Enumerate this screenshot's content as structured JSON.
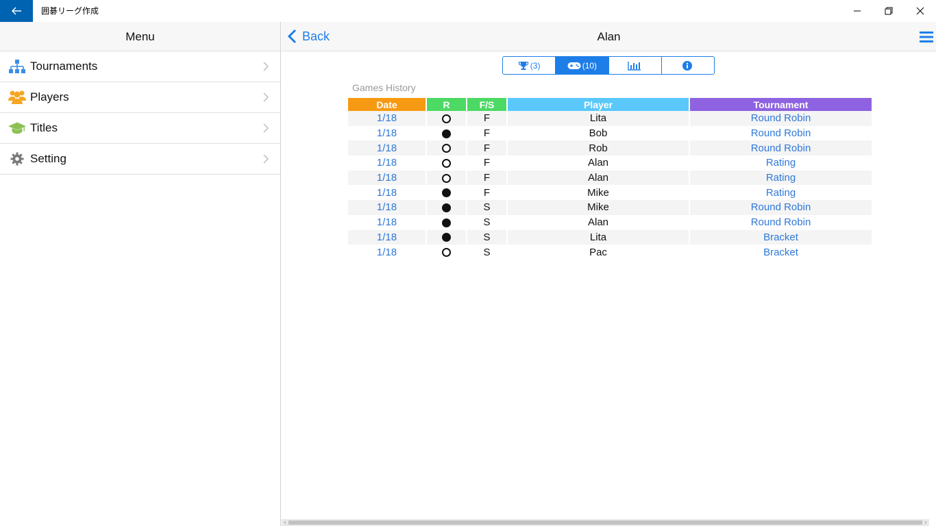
{
  "window": {
    "title": "囲碁リーグ作成"
  },
  "menu": {
    "title": "Menu",
    "items": [
      {
        "label": "Tournaments",
        "icon": "sitemap-icon",
        "color": "#3b8ee8"
      },
      {
        "label": "Players",
        "icon": "users-icon",
        "color": "#f5a623"
      },
      {
        "label": "Titles",
        "icon": "graduation-cap-icon",
        "color": "#8cc152"
      },
      {
        "label": "Setting",
        "icon": "gear-icon",
        "color": "#7a7a7a"
      }
    ]
  },
  "nav": {
    "back_label": "Back",
    "title": "Alan"
  },
  "tabs": [
    {
      "icon": "trophy-icon",
      "label": "(3)",
      "active": false
    },
    {
      "icon": "gamepad-icon",
      "label": "(10)",
      "active": true
    },
    {
      "icon": "bar-chart-icon",
      "label": "",
      "active": false
    },
    {
      "icon": "info-icon",
      "label": "",
      "active": false
    }
  ],
  "history": {
    "section_label": "Games History",
    "columns": {
      "date": "Date",
      "r": "R",
      "fs": "F/S",
      "player": "Player",
      "tournament": "Tournament"
    },
    "header_colors": {
      "date": "#f79a13",
      "r": "#4cd964",
      "fs": "#4cd964",
      "player": "#5ac8fa",
      "tournament": "#8e62e0"
    },
    "rows": [
      {
        "date": "1/18",
        "result": "white",
        "fs": "F",
        "player": "Lita",
        "tournament": "Round Robin"
      },
      {
        "date": "1/18",
        "result": "black",
        "fs": "F",
        "player": "Bob",
        "tournament": "Round Robin"
      },
      {
        "date": "1/18",
        "result": "white",
        "fs": "F",
        "player": "Rob",
        "tournament": "Round Robin"
      },
      {
        "date": "1/18",
        "result": "white",
        "fs": "F",
        "player": "Alan",
        "tournament": "Rating"
      },
      {
        "date": "1/18",
        "result": "white",
        "fs": "F",
        "player": "Alan",
        "tournament": "Rating"
      },
      {
        "date": "1/18",
        "result": "black",
        "fs": "F",
        "player": "Mike",
        "tournament": "Rating"
      },
      {
        "date": "1/18",
        "result": "black",
        "fs": "S",
        "player": "Mike",
        "tournament": "Round Robin"
      },
      {
        "date": "1/18",
        "result": "black",
        "fs": "S",
        "player": "Alan",
        "tournament": "Round Robin"
      },
      {
        "date": "1/18",
        "result": "black",
        "fs": "S",
        "player": "Lita",
        "tournament": "Bracket"
      },
      {
        "date": "1/18",
        "result": "white",
        "fs": "S",
        "player": "Pac",
        "tournament": "Bracket"
      }
    ]
  },
  "accent": "#1e7ee8"
}
